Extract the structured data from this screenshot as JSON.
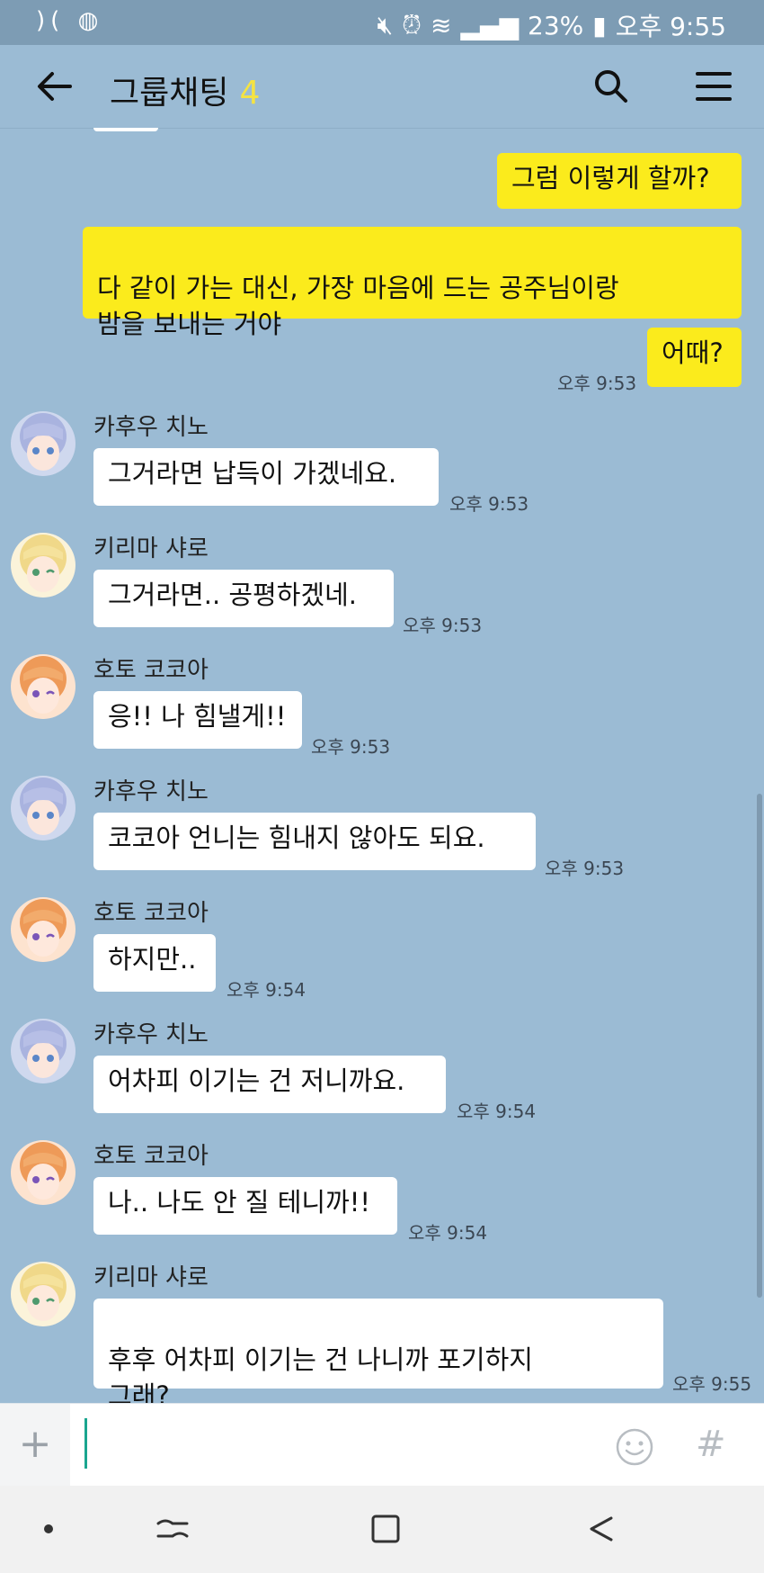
{
  "status_bar": {
    "battery": "23%",
    "time": "오후 9:55"
  },
  "header": {
    "title": "그룹채팅",
    "member_count": "4"
  },
  "messages": [
    {
      "side": "mine",
      "text": "그럼 이렇게 할까?"
    },
    {
      "side": "mine",
      "text": "다 같이 가는 대신, 가장 마음에 드는 공주님이랑\n밤을 보내는 거야"
    },
    {
      "side": "mine",
      "text": "어때?",
      "time": "오후 9:53"
    },
    {
      "side": "theirs",
      "sender": "카후우 치노",
      "text": "그거라면 납득이 가겠네요.",
      "time": "오후 9:53"
    },
    {
      "side": "theirs",
      "sender": "키리마 샤로",
      "text": "그거라면.. 공평하겠네.",
      "time": "오후 9:53"
    },
    {
      "side": "theirs",
      "sender": "호토 코코아",
      "text": "응!! 나 힘낼게!!",
      "time": "오후 9:53"
    },
    {
      "side": "theirs",
      "sender": "카후우 치노",
      "text": "코코아 언니는 힘내지 않아도 되요.",
      "time": "오후 9:53"
    },
    {
      "side": "theirs",
      "sender": "호토 코코아",
      "text": "하지만..",
      "time": "오후 9:54"
    },
    {
      "side": "theirs",
      "sender": "카후우 치노",
      "text": "어차피 이기는 건 저니까요.",
      "time": "오후 9:54"
    },
    {
      "side": "theirs",
      "sender": "호토 코코아",
      "text": "나.. 나도 안 질 테니까!!",
      "time": "오후 9:54"
    },
    {
      "side": "theirs",
      "sender": "키리마 샤로",
      "text": "후후 어차피 이기는 건 나니까 포기하지\n그래?",
      "time": "오후 9:55"
    }
  ],
  "input": {
    "value": "",
    "hash_label": "#"
  },
  "icons": {
    "back": "arrow-left-icon",
    "search": "search-icon",
    "menu": "hamburger-menu-icon",
    "plus": "plus-icon",
    "emoji": "emoji-icon",
    "hash": "hash-icon"
  },
  "colors": {
    "background": "#9bbbd4",
    "my_bubble": "#fbeb1c",
    "their_bubble": "#ffffff",
    "member_count": "#f5e342"
  }
}
